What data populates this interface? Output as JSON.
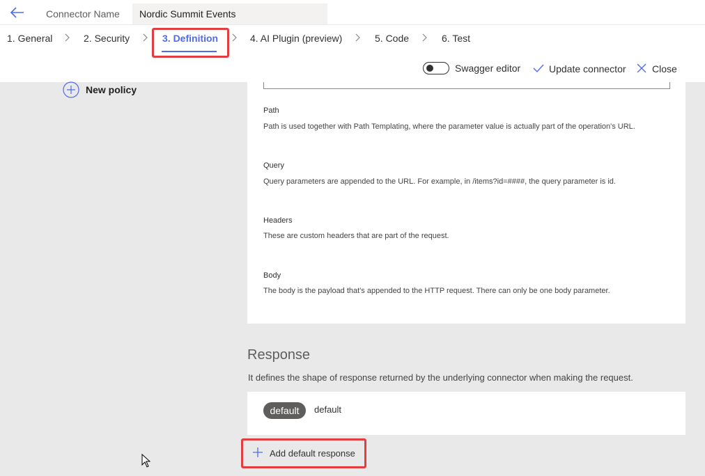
{
  "header": {
    "connector_name_label": "Connector Name",
    "connector_name_value": "Nordic Summit Events"
  },
  "tabs": [
    {
      "label": "1. General"
    },
    {
      "label": "2. Security"
    },
    {
      "label": "3. Definition",
      "active": true
    },
    {
      "label": "4. AI Plugin (preview)"
    },
    {
      "label": "5. Code"
    },
    {
      "label": "6. Test"
    }
  ],
  "actions": {
    "swagger_editor": "Swagger editor",
    "swagger_editor_on": false,
    "update_connector": "Update connector",
    "close": "Close"
  },
  "sidebar": {
    "new_policy": "New policy"
  },
  "parameters": [
    {
      "title": "Path",
      "description": "Path is used together with Path Templating, where the parameter value is actually part of the operation's URL."
    },
    {
      "title": "Query",
      "description": "Query parameters are appended to the URL. For example, in /items?id=####, the query parameter is id."
    },
    {
      "title": "Headers",
      "description": "These are custom headers that are part of the request."
    },
    {
      "title": "Body",
      "description": "The body is the payload that's appended to the HTTP request. There can only be one body parameter."
    }
  ],
  "response": {
    "title": "Response",
    "description": "It defines the shape of response returned by the underlying connector when making the request.",
    "pill": "default",
    "pill_label": "default",
    "add_button": "Add default response"
  },
  "colors": {
    "accent": "#4f6bed",
    "highlight": "#e13e41",
    "body_bg": "#e9e9e9"
  }
}
